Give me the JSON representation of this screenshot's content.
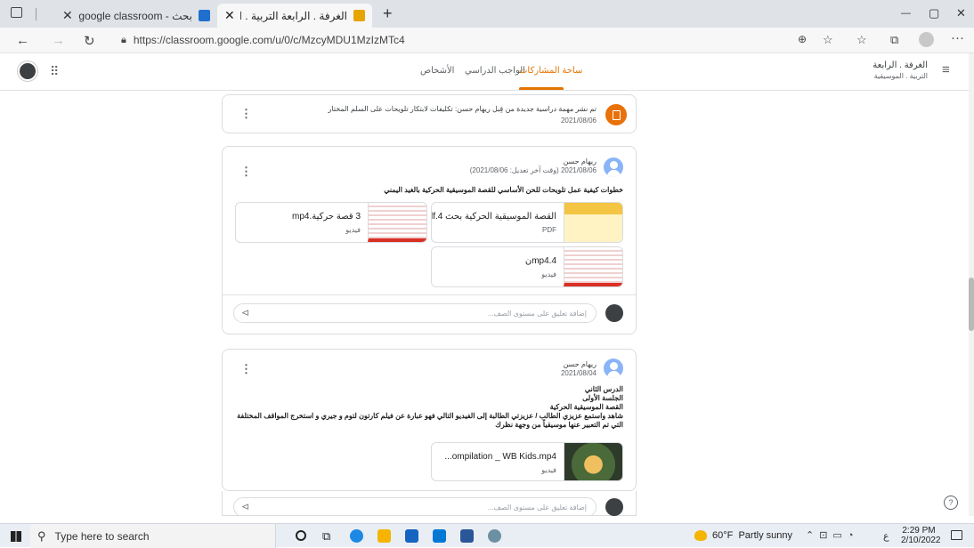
{
  "browser": {
    "tabs": [
      {
        "title": "بحث - google classroom",
        "active": false
      },
      {
        "title": "الغرفة . الرابعة التربية . الموسيقية",
        "active": true
      }
    ],
    "new_tab": "+",
    "url": "https://classroom.google.com/u/0/c/MzcyMDU1MzIzMTc4",
    "window_controls": [
      "—",
      "▢",
      "✕"
    ]
  },
  "classroom": {
    "class_name_line1": "الغرفة . الرابعة",
    "class_name_line2": "التربية . الموسيقية",
    "tabs": [
      "ساحة المشاركات",
      "الواجب الدراسي",
      "الأشخاص"
    ],
    "active_tab": "ساحة المشاركات"
  },
  "stream": {
    "assignment_notice": {
      "text": "تم نشر مهمة دراسية جديدة من قِبل ريهام حسن: تكليفات لابتكار تلويحات على السلم المختار",
      "date": "2021/08/06"
    },
    "post1": {
      "author": "ريهام حسن",
      "meta": "2021/08/06 (وقت آخر تعديل: 2021/08/06)",
      "body": "خطوات كيفية عمل تلويحات للحن الأساسي للقصة الموسيقية الحركية بالغيد اليمني",
      "attachments": [
        {
          "name": "القصة الموسيقية الحركية بحث 4.pdf",
          "type": "PDF"
        },
        {
          "name": "3 قصة حركية.mp4",
          "type": "فيديو"
        },
        {
          "name": "4.mp4ن",
          "type": "فيديو"
        }
      ],
      "comment_placeholder": "إضافة تعليق على مستوى الصف..."
    },
    "post2": {
      "author": "ريهام حسن",
      "date": "2021/08/04",
      "lines": [
        "الدرس الثاني",
        "الجلسة الأولى",
        "القصة الموسيقية الحركية",
        "شاهد واستمع عزيزي الطالب / عزيزتي الطالبة إلى الفيديو التالي فهو عبارة عن فيلم كارتون لتوم و جيري و استخرج المواقف المختلفة التي تم التعبير عنها موسيقياً من وجهة نظرك"
      ],
      "attachment": {
        "name": "...ompilation _ WB Kids.mp4",
        "type": "فيديو"
      },
      "comment_placeholder": "إضافة تعليق على مستوى الصف..."
    },
    "help_icon": "?"
  },
  "taskbar": {
    "search_placeholder": "Type here to search",
    "weather": "60°F  Partly sunny",
    "time": "2:29 PM",
    "date": "2/10/2022",
    "lang": "ع"
  },
  "colors": {
    "accent": "#e37400",
    "avatar": "#8ab4f8",
    "assignment_icon": "#e8710a"
  }
}
